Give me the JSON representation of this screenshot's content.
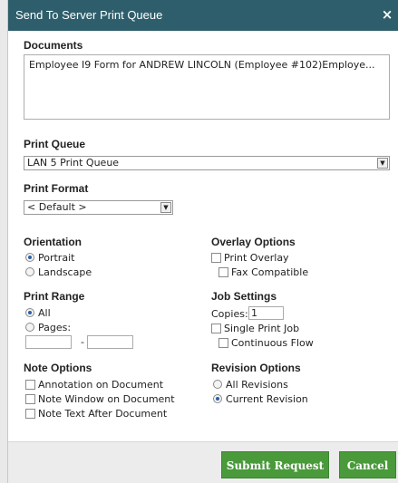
{
  "dialog": {
    "title": "Send To Server Print Queue",
    "close_icon": "×"
  },
  "documents": {
    "label": "Documents",
    "text": "Employee I9 Form for ANDREW LINCOLN (Employee #102)Employe..."
  },
  "print_queue": {
    "label": "Print Queue",
    "selected": "LAN 5 Print Queue"
  },
  "print_format": {
    "label": "Print Format",
    "selected": "< Default >"
  },
  "orientation": {
    "label": "Orientation",
    "options": [
      "Portrait",
      "Landscape"
    ],
    "selected": "Portrait"
  },
  "overlay_options": {
    "label": "Overlay Options",
    "print_overlay": "Print Overlay",
    "fax_compatible": "Fax Compatible"
  },
  "print_range": {
    "label": "Print Range",
    "all": "All",
    "pages": "Pages:",
    "selected": "All",
    "separator": "-"
  },
  "job_settings": {
    "label": "Job Settings",
    "copies_label": "Copies:",
    "copies_value": "1",
    "single_print_job": "Single Print Job",
    "continuous_flow": "Continuous Flow"
  },
  "note_options": {
    "label": "Note Options",
    "items": [
      "Annotation on Document",
      "Note Window on Document",
      "Note Text After Document"
    ]
  },
  "revision_options": {
    "label": "Revision Options",
    "options": [
      "All Revisions",
      "Current Revision"
    ],
    "selected": "Current Revision"
  },
  "footer": {
    "submit_label": "Submit Request",
    "cancel_label": "Cancel"
  },
  "colors": {
    "titlebar": "#2e5e6b",
    "button_green": "#4a9a3b"
  },
  "icons": {
    "close": "close-icon",
    "dropdown": "chevron-down-icon"
  }
}
